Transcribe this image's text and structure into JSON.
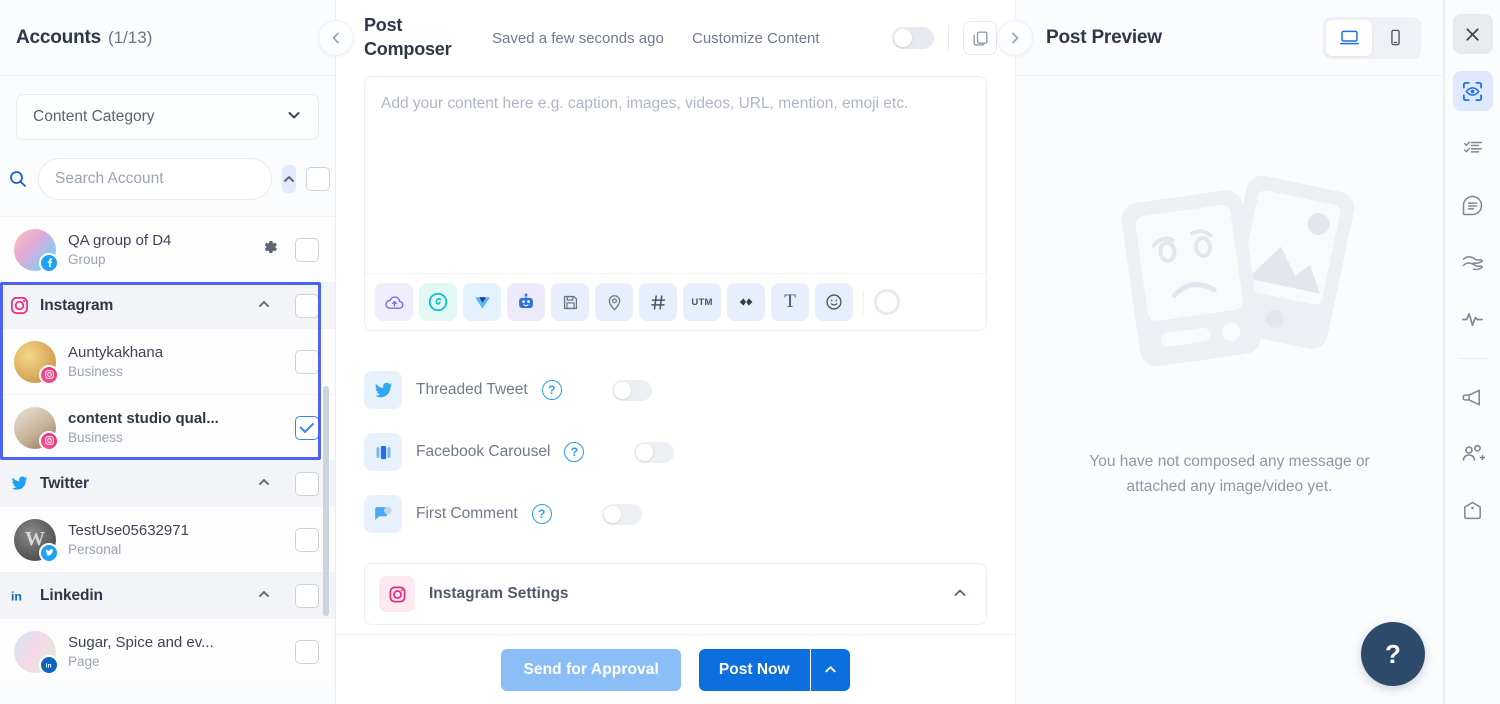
{
  "sidebar": {
    "title": "Accounts",
    "count": "(1/13)",
    "collapse_icon": "chevron-left-icon",
    "category": {
      "label": "Content Category",
      "icon": "chevron-down-icon"
    },
    "search": {
      "placeholder": "Search Account",
      "icon": "search-icon",
      "value": ""
    },
    "collapse_all_icon": "chevron-up-icon",
    "rows": [
      {
        "type": "account",
        "name": "QA group of D4",
        "sub": "Group",
        "network": "facebook",
        "checked": false,
        "has_gear": true
      },
      {
        "type": "group",
        "name": "Instagram",
        "network": "instagram",
        "checked": false,
        "expanded": true
      },
      {
        "type": "account",
        "name": "Auntykakhana",
        "sub": "Business",
        "network": "instagram",
        "checked": false,
        "has_gear": false
      },
      {
        "type": "account",
        "name": "content studio qual...",
        "sub": "Business",
        "network": "instagram",
        "checked": true,
        "has_gear": false,
        "bold": true
      },
      {
        "type": "group",
        "name": "Twitter",
        "network": "twitter",
        "checked": false,
        "expanded": true
      },
      {
        "type": "account",
        "name": "TestUse05632971",
        "sub": "Personal",
        "network": "twitter",
        "checked": false,
        "has_gear": false
      },
      {
        "type": "group",
        "name": "Linkedin",
        "network": "linkedin",
        "checked": false,
        "expanded": true
      },
      {
        "type": "account",
        "name": "Sugar, Spice and ev...",
        "sub": "Page",
        "network": "linkedin",
        "checked": false,
        "has_gear": false
      }
    ]
  },
  "composer": {
    "title": "Post Composer",
    "saved_status": "Saved a few seconds ago",
    "customize_label": "Customize Content",
    "customize_toggle_on": false,
    "copy_icon": "copy-icon",
    "next_icon": "chevron-right-icon",
    "editor_placeholder": "Add your content here e.g. caption, images, videos, URL, mention, emoji etc.",
    "editor_value": "",
    "toolbar": [
      {
        "name": "upload-media-icon",
        "glyph": "cloud-up"
      },
      {
        "name": "canva-icon",
        "glyph": "canva"
      },
      {
        "name": "vista-create-icon",
        "glyph": "vista"
      },
      {
        "name": "ai-assistant-icon",
        "glyph": "robot"
      },
      {
        "name": "save-draft-icon",
        "glyph": "save"
      },
      {
        "name": "location-icon",
        "glyph": "pin"
      },
      {
        "name": "hashtag-icon",
        "glyph": "hash"
      },
      {
        "name": "utm-icon",
        "glyph": "UTM"
      },
      {
        "name": "shorten-link-icon",
        "glyph": "link"
      },
      {
        "name": "text-format-icon",
        "glyph": "T"
      },
      {
        "name": "emoji-icon",
        "glyph": "smiley"
      },
      {
        "name": "character-counter-icon",
        "glyph": "ring"
      }
    ],
    "options": [
      {
        "label": "Threaded Tweet",
        "network": "twitter",
        "help": "?",
        "enabled": false
      },
      {
        "label": "Facebook Carousel",
        "network": "facebook-carousel",
        "help": "?",
        "enabled": false
      },
      {
        "label": "First Comment",
        "network": "comment",
        "help": "?",
        "enabled": false
      }
    ],
    "settings_section": {
      "label": "Instagram Settings",
      "icon": "instagram-icon",
      "chevron": "chevron-up-icon"
    },
    "footer": {
      "approval_label": "Send for Approval",
      "post_label": "Post Now",
      "post_arrow_icon": "chevron-up-icon"
    }
  },
  "preview": {
    "title": "Post Preview",
    "devices": [
      {
        "name": "desktop-view",
        "icon": "monitor-icon",
        "active": true
      },
      {
        "name": "mobile-view",
        "icon": "phone-icon",
        "active": false
      }
    ],
    "empty_message": "You have not composed any message or attached any image/video yet.",
    "help_label": "?"
  },
  "rail": {
    "items": [
      {
        "name": "close-panel",
        "icon": "close-icon",
        "style": "close"
      },
      {
        "name": "preview-toggle",
        "icon": "eye-scan-icon",
        "style": "active"
      },
      {
        "name": "tasks",
        "icon": "checklist-icon",
        "style": "normal"
      },
      {
        "name": "notes",
        "icon": "notes-icon",
        "style": "normal"
      },
      {
        "name": "approvals",
        "icon": "hands-icon",
        "style": "normal"
      },
      {
        "name": "activity",
        "icon": "pulse-icon",
        "style": "normal"
      },
      {
        "name": "campaigns",
        "icon": "megaphone-icon",
        "style": "normal"
      },
      {
        "name": "assign-member",
        "icon": "add-user-icon",
        "style": "normal"
      },
      {
        "name": "labels",
        "icon": "tag-icon",
        "style": "normal"
      }
    ]
  },
  "colors": {
    "accent_blue": "#0b6fe0",
    "selection_border": "#4d63f5",
    "instagram_pink": "#ee2a7b",
    "twitter_blue": "#1da1f2",
    "linkedin_blue": "#0a66c2"
  }
}
